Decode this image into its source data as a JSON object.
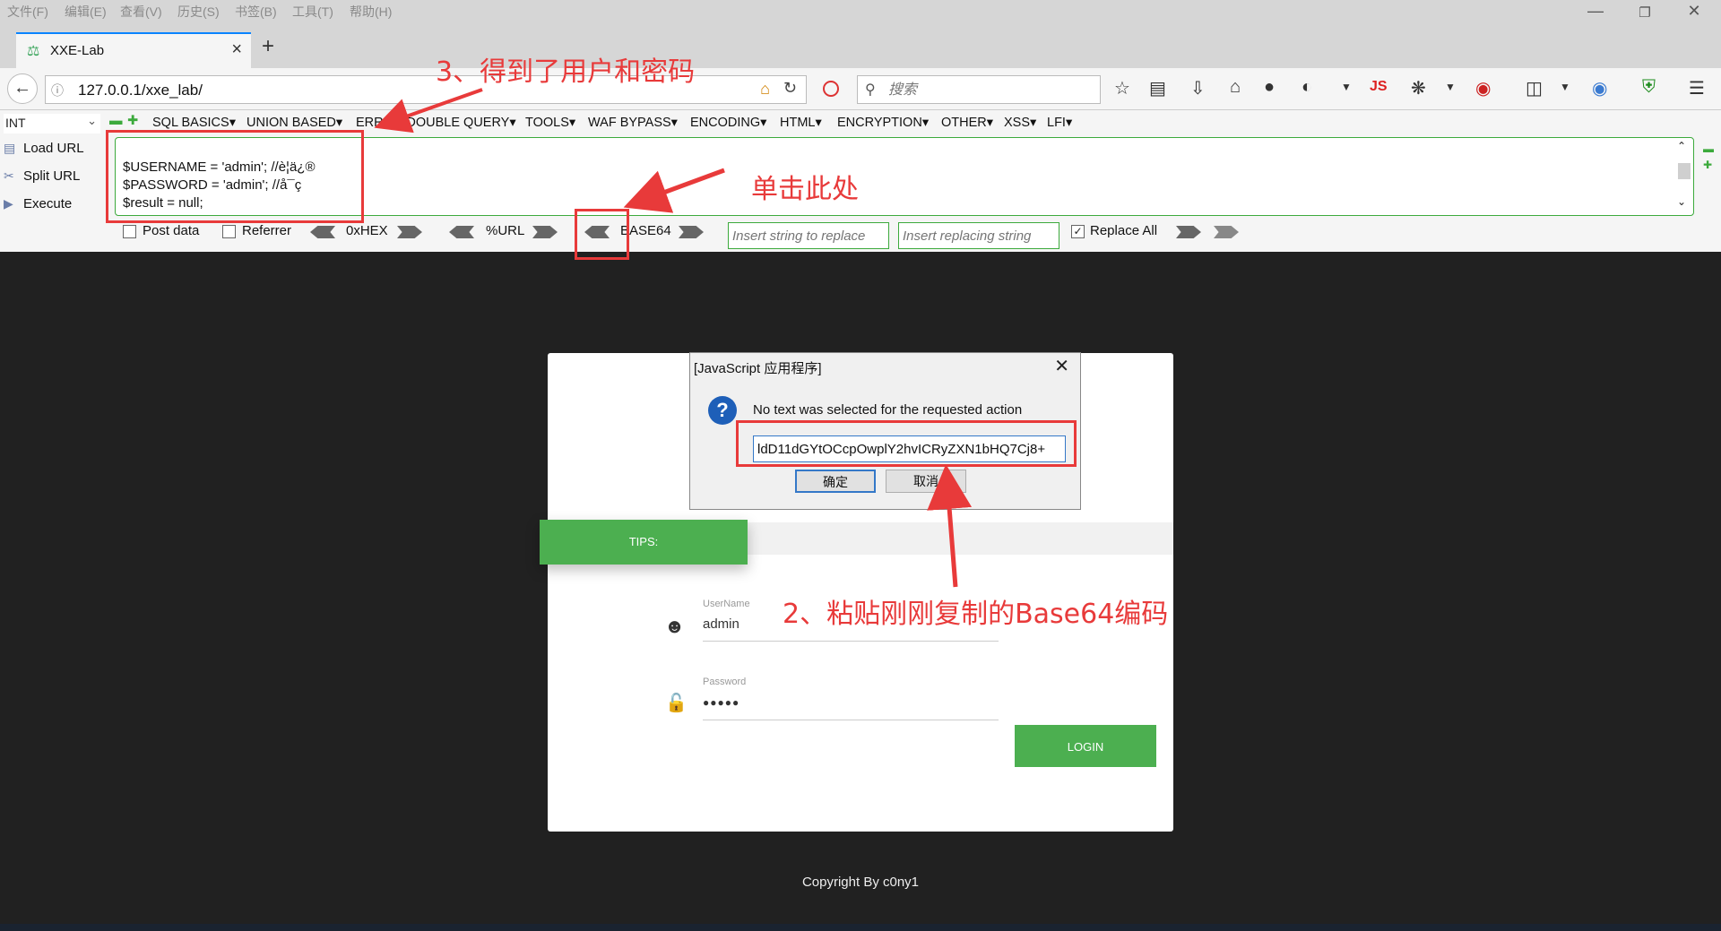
{
  "menubar": {
    "items": [
      "文件(F)",
      "编辑(E)",
      "查看(V)",
      "历史(S)",
      "书签(B)",
      "工具(T)",
      "帮助(H)"
    ]
  },
  "tab": {
    "title": "XXE-Lab"
  },
  "navbar": {
    "url": "127.0.0.1/xxe_lab/",
    "search_placeholder": "搜索"
  },
  "hackbar": {
    "select_value": "INT",
    "menu": [
      "SQL BASICS",
      "UNION BASED",
      "ERROR/DOUBLE QUERY",
      "TOOLS",
      "WAF BYPASS",
      "ENCODING",
      "HTML",
      "ENCRYPTION",
      "OTHER",
      "XSS",
      "LFI"
    ],
    "side": [
      "Load URL",
      "Split URL",
      "Execute"
    ],
    "text_lines": [
      "$USERNAME = 'admin'; //è¦ä¿®",
      "$PASSWORD = 'admin'; //å¯ç",
      "$result = null;"
    ],
    "post_data": "Post data",
    "referrer": "Referrer",
    "hex": "0xHEX",
    "url": "%URL",
    "base64": "BASE64",
    "replace_placeholder": "Insert string to replace",
    "replacing_placeholder": "Insert replacing string",
    "replace_all": "Replace All"
  },
  "login": {
    "tips": "TIPS:",
    "username_label": "UserName",
    "username_value": "admin",
    "password_label": "Password",
    "password_value": "●●●●●",
    "login_button": "LOGIN",
    "copyright": "Copyright By c0ny1"
  },
  "dialog": {
    "title": "[JavaScript 应用程序]",
    "message": "No text was selected for the requested action",
    "input_value": "ldD11dGYtOCcpOwplY2hvICRyZXN1bHQ7Cj8+",
    "ok": "确定",
    "cancel": "取消"
  },
  "annotations": {
    "step3": "3、得到了用户和密码",
    "click_here": "单击此处",
    "step2": "2、粘贴刚刚复制的Base64编码"
  },
  "colors": {
    "accent_red": "#e83a3a",
    "green": "#4caf50",
    "page_bg": "#212121"
  }
}
